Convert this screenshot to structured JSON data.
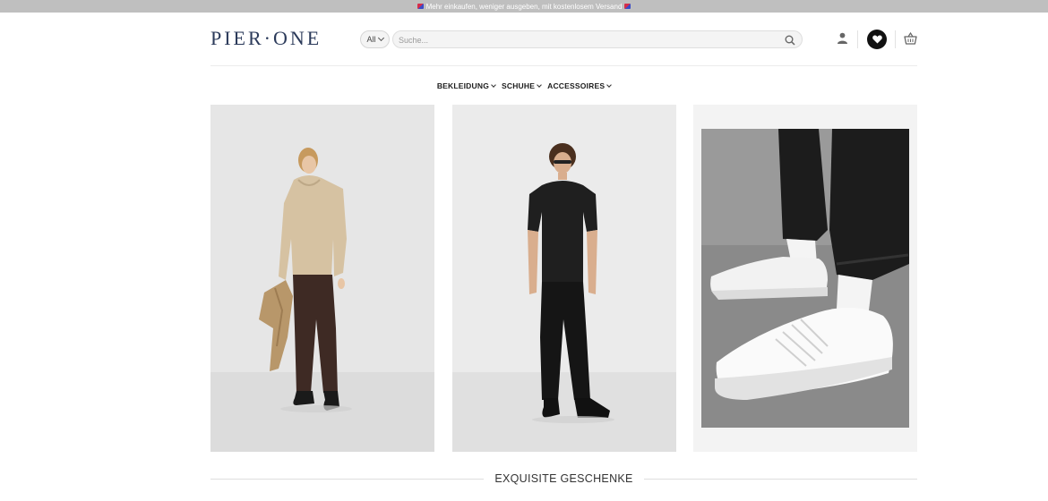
{
  "promo": {
    "text": "Mehr einkaufen, weniger ausgeben, mit kostenlosem Versand",
    "icon": "flag-icon"
  },
  "header": {
    "logo": "PIER·ONE",
    "category_select": "All",
    "search_placeholder": "Suche...",
    "icons": [
      "user-icon",
      "heart-icon",
      "cart-icon"
    ]
  },
  "nav": {
    "items": [
      {
        "label": "BEKLEIDUNG"
      },
      {
        "label": "SCHUHE"
      },
      {
        "label": "ACCESSOIRES"
      }
    ]
  },
  "products": [
    {
      "image": "man-in-beige-hoodie-brown-trousers"
    },
    {
      "image": "man-in-black-tshirt-black-jeans"
    },
    {
      "image": "white-sneakers-black-joggers"
    }
  ],
  "section": {
    "title": "EXQUISITE GESCHENKE"
  },
  "colors": {
    "topbar": "#bfbfbf",
    "logo": "#2b3a5a",
    "heart_bg": "#111111"
  }
}
